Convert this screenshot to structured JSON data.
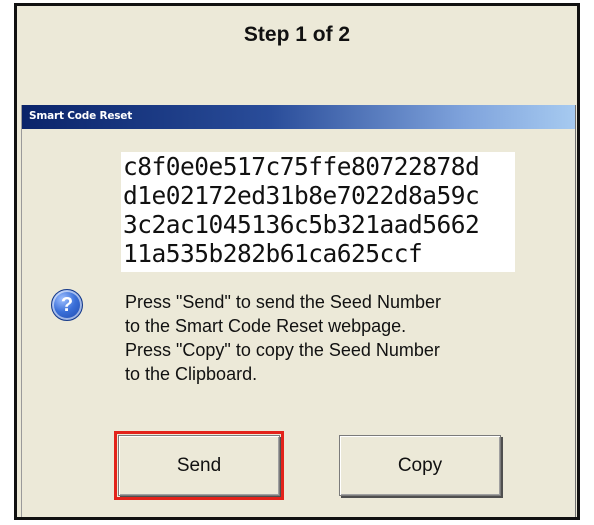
{
  "header": {
    "title": "Step 1 of 2"
  },
  "dialog": {
    "title": "Smart Code Reset",
    "seed_lines": [
      "c8f0e0e517c75ffe80722878d",
      "d1e02172ed31b8e7022d8a59c",
      "3c2ac1045136c5b321aad5662",
      "11a535b282b61ca625ccf"
    ],
    "icon": {
      "name": "question-icon",
      "glyph": "?"
    },
    "message_lines": [
      "Press \"Send\" to send the Seed Number",
      "to the Smart Code Reset webpage.",
      "Press \"Copy\" to copy the Seed Number",
      "to the Clipboard."
    ],
    "buttons": {
      "send_label": "Send",
      "copy_label": "Copy"
    }
  },
  "colors": {
    "dialog_background": "#ece9d8",
    "titlebar_start": "#0a246a",
    "titlebar_end": "#a6caf0",
    "highlight": "#e3231b"
  }
}
